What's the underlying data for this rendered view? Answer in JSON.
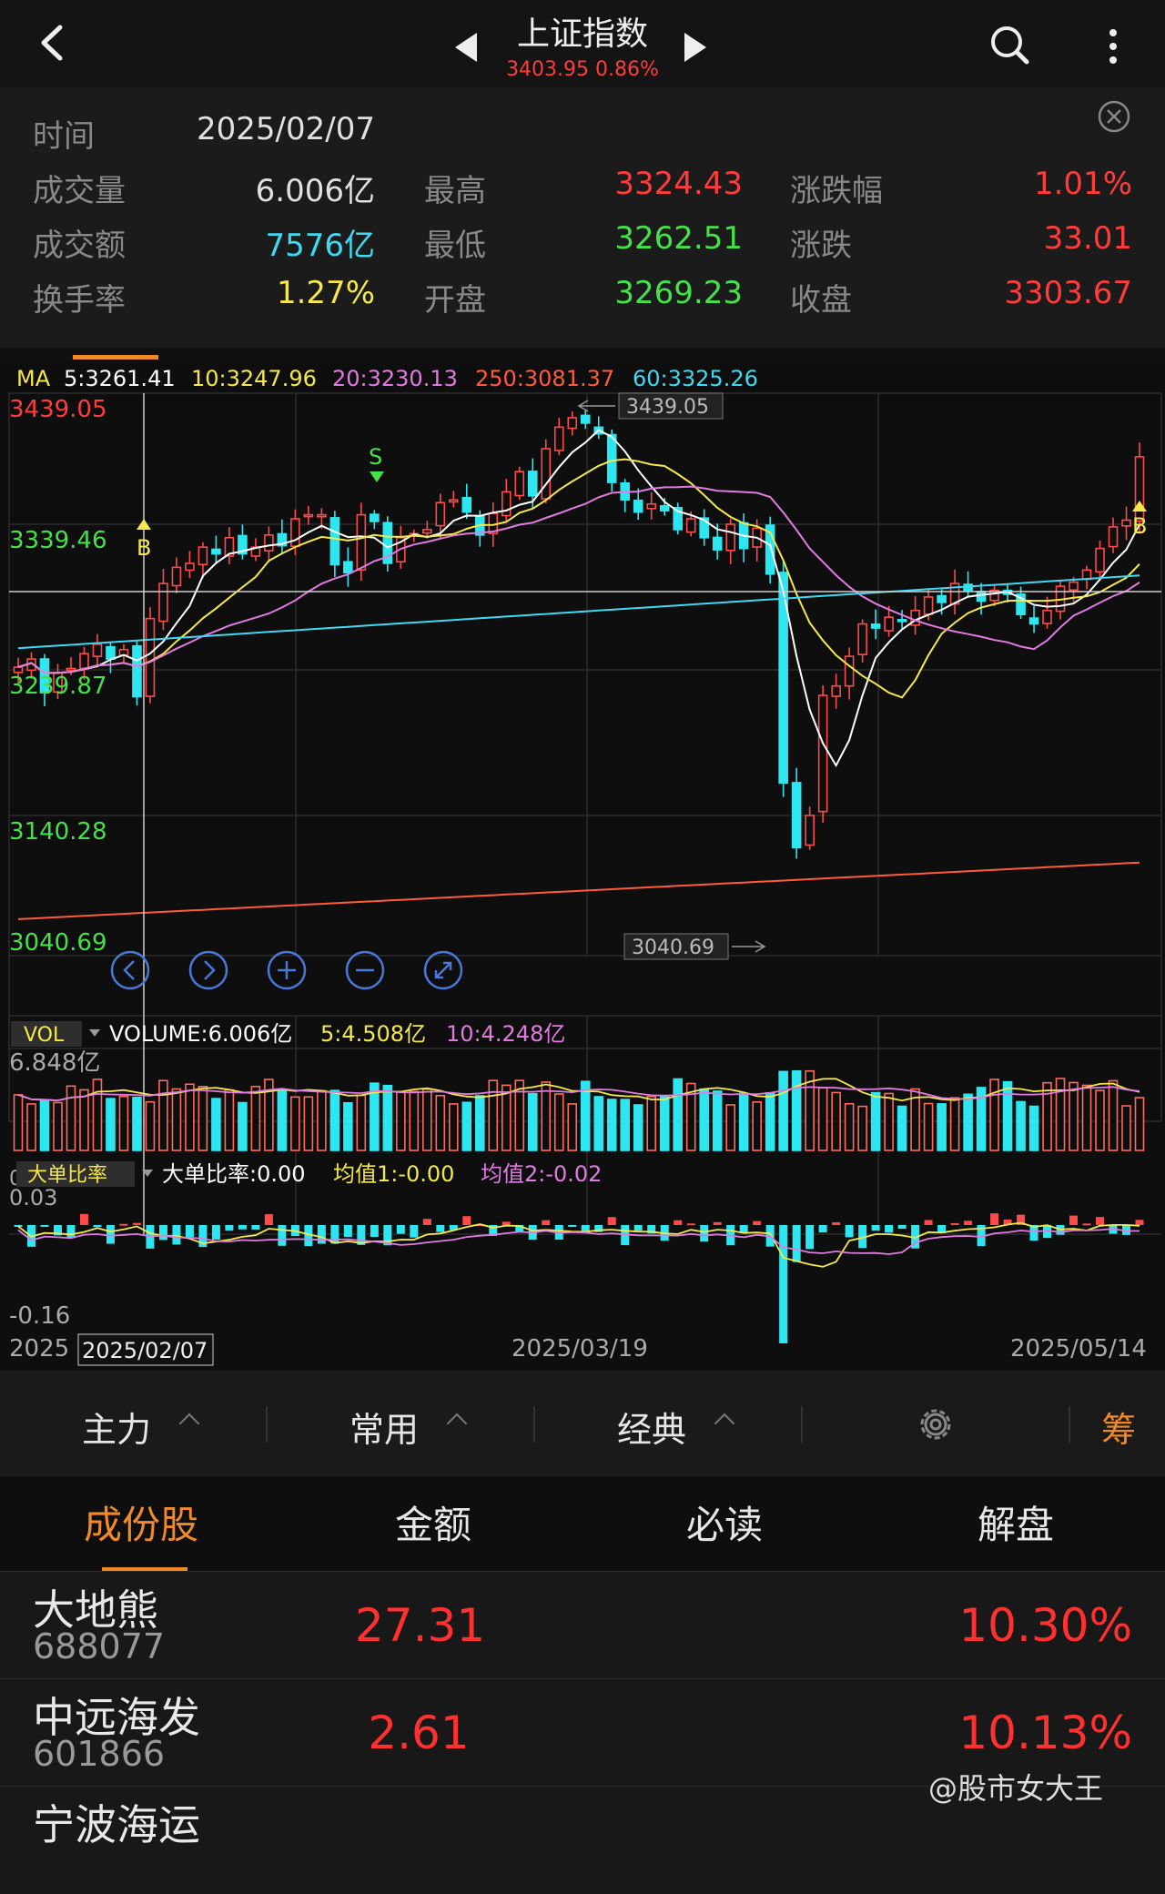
{
  "header": {
    "title": "上证指数",
    "subtitle": "3403.95 0.86%",
    "nav_prev_icon": "left-triangle-icon",
    "nav_next_icon": "right-triangle-icon"
  },
  "info": {
    "time_label": "时间",
    "time_value": "2025/02/07",
    "rows": [
      {
        "l1": "成交量",
        "v1": "6.006亿",
        "c1": "#e0e0e0",
        "l2": "最高",
        "v2": "3324.43",
        "c2": "#ff3b3b",
        "l3": "涨跌幅",
        "v3": "1.01%",
        "c3": "#ff3b3b"
      },
      {
        "l1": "成交额",
        "v1": "7576亿",
        "c1": "#3fd9f2",
        "l2": "最低",
        "v2": "3262.51",
        "c2": "#45e04a",
        "l3": "涨跌",
        "v3": "33.01",
        "c3": "#ff3b3b"
      },
      {
        "l1": "换手率",
        "v1": "1.27%",
        "c1": "#f5e84a",
        "l2": "开盘",
        "v2": "3269.23",
        "c2": "#45e04a",
        "l3": "收盘",
        "v3": "3303.67",
        "c3": "#ff3b3b"
      }
    ]
  },
  "ma_legend": [
    {
      "text": "MA",
      "color": "#f5e84a"
    },
    {
      "text": "5:3261.41",
      "color": "#ffffff"
    },
    {
      "text": "10:3247.96",
      "color": "#f5e84a"
    },
    {
      "text": "20:3230.13",
      "color": "#e07be0"
    },
    {
      "text": "250:3081.37",
      "color": "#ff5a3c"
    },
    {
      "text": "60:3325.26",
      "color": "#3fd9f2"
    }
  ],
  "price_axis": {
    "top": "3439.05",
    "l2": "3339.46",
    "l3": "3239.87",
    "l4": "3140.28",
    "bottom": "3040.69",
    "max_callout": "3439.05",
    "min_callout": "3040.69"
  },
  "signals": {
    "s": "S",
    "b1": "B",
    "b2": "B"
  },
  "zoom_controls": [
    "prev-icon",
    "next-icon",
    "zoom-in-icon",
    "zoom-out-icon",
    "fullscreen-icon"
  ],
  "volume": {
    "tag": "VOL",
    "text": "VOLUME:6.006亿",
    "ma5": "5:4.508亿",
    "ma10": "10:4.248亿",
    "max": "6.848亿",
    "zero": "0"
  },
  "bigorder": {
    "tag": "大单比率",
    "text": "大单比率:0.00",
    "avg1": "均值1:-0.00",
    "avg2": "均值2:-0.02",
    "top": "0.03",
    "bottom": "-0.16"
  },
  "dates": {
    "start": "2025",
    "cursor": "2025/02/07",
    "mid": "2025/03/19",
    "end": "2025/05/14"
  },
  "chart_data": {
    "type": "candlestick",
    "title": "上证指数",
    "ylim": [
      3040.69,
      3439.05
    ],
    "ma_lines": [
      "MA5",
      "MA10",
      "MA20",
      "MA250",
      "MA60"
    ],
    "cursor": {
      "date": "2025/02/07",
      "open": 3269.23,
      "high": 3324.43,
      "low": 3262.51,
      "close": 3303.67,
      "volume": "6.006亿"
    },
    "close_series": [
      3248,
      3254,
      3229,
      3244,
      3247,
      3258,
      3265,
      3254,
      3261,
      3226,
      3284,
      3310,
      3322,
      3325,
      3337,
      3332,
      3344,
      3332,
      3337,
      3346,
      3338,
      3358,
      3361,
      3361,
      3324,
      3318,
      3361,
      3356,
      3325,
      3344,
      3347,
      3350,
      3370,
      3372,
      3363,
      3346,
      3362,
      3378,
      3393,
      3375,
      3410,
      3426,
      3433,
      3429,
      3421,
      3385,
      3372,
      3363,
      3369,
      3364,
      3350,
      3358,
      3344,
      3335,
      3354,
      3336,
      3351,
      3317,
      3162,
      3114,
      3138,
      3227,
      3234,
      3256,
      3280,
      3277,
      3285,
      3282,
      3290,
      3300,
      3296,
      3310,
      3305,
      3297,
      3305,
      3302,
      3287,
      3280,
      3290,
      3308,
      3311,
      3320,
      3336,
      3352,
      3357,
      3404
    ]
  },
  "tabs": [
    "主力",
    "常用",
    "经典"
  ],
  "tab_chip": "筹",
  "subtabs": {
    "active": "成份股",
    "t2": "金额",
    "t3": "必读",
    "t4": "解盘"
  },
  "stocks": [
    {
      "name": "大地熊",
      "code": "688077",
      "amount": "27.31",
      "pct": "10.30%"
    },
    {
      "name": "中远海发",
      "code": "601866",
      "amount": "2.61",
      "pct": "10.13%"
    },
    {
      "name": "宁波海运",
      "code": "",
      "amount": "",
      "pct": ""
    }
  ],
  "watermark": "@股市女大王"
}
